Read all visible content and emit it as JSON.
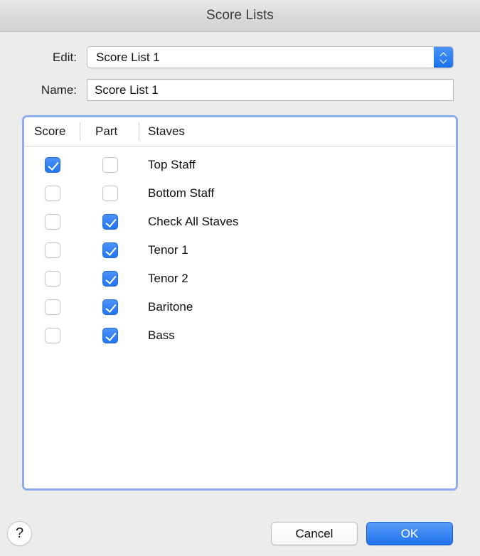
{
  "window": {
    "title": "Score Lists"
  },
  "form": {
    "edit_label": "Edit:",
    "edit_value": "Score List 1",
    "name_label": "Name:",
    "name_value": "Score List 1"
  },
  "table": {
    "columns": [
      "Score",
      "Part",
      "Staves"
    ],
    "rows": [
      {
        "score": true,
        "part": false,
        "staves": "Top Staff"
      },
      {
        "score": false,
        "part": false,
        "staves": "Bottom Staff"
      },
      {
        "score": false,
        "part": true,
        "staves": "Check All Staves"
      },
      {
        "score": false,
        "part": true,
        "staves": "Tenor 1"
      },
      {
        "score": false,
        "part": true,
        "staves": "Tenor 2"
      },
      {
        "score": false,
        "part": true,
        "staves": "Baritone"
      },
      {
        "score": false,
        "part": true,
        "staves": "Bass"
      }
    ]
  },
  "footer": {
    "help_label": "?",
    "cancel_label": "Cancel",
    "ok_label": "OK"
  },
  "colors": {
    "accent": "#1f76f0",
    "focus_ring": "#8cacec",
    "window_bg": "#ececec",
    "titlebar_bg": "#d9d9d9"
  }
}
